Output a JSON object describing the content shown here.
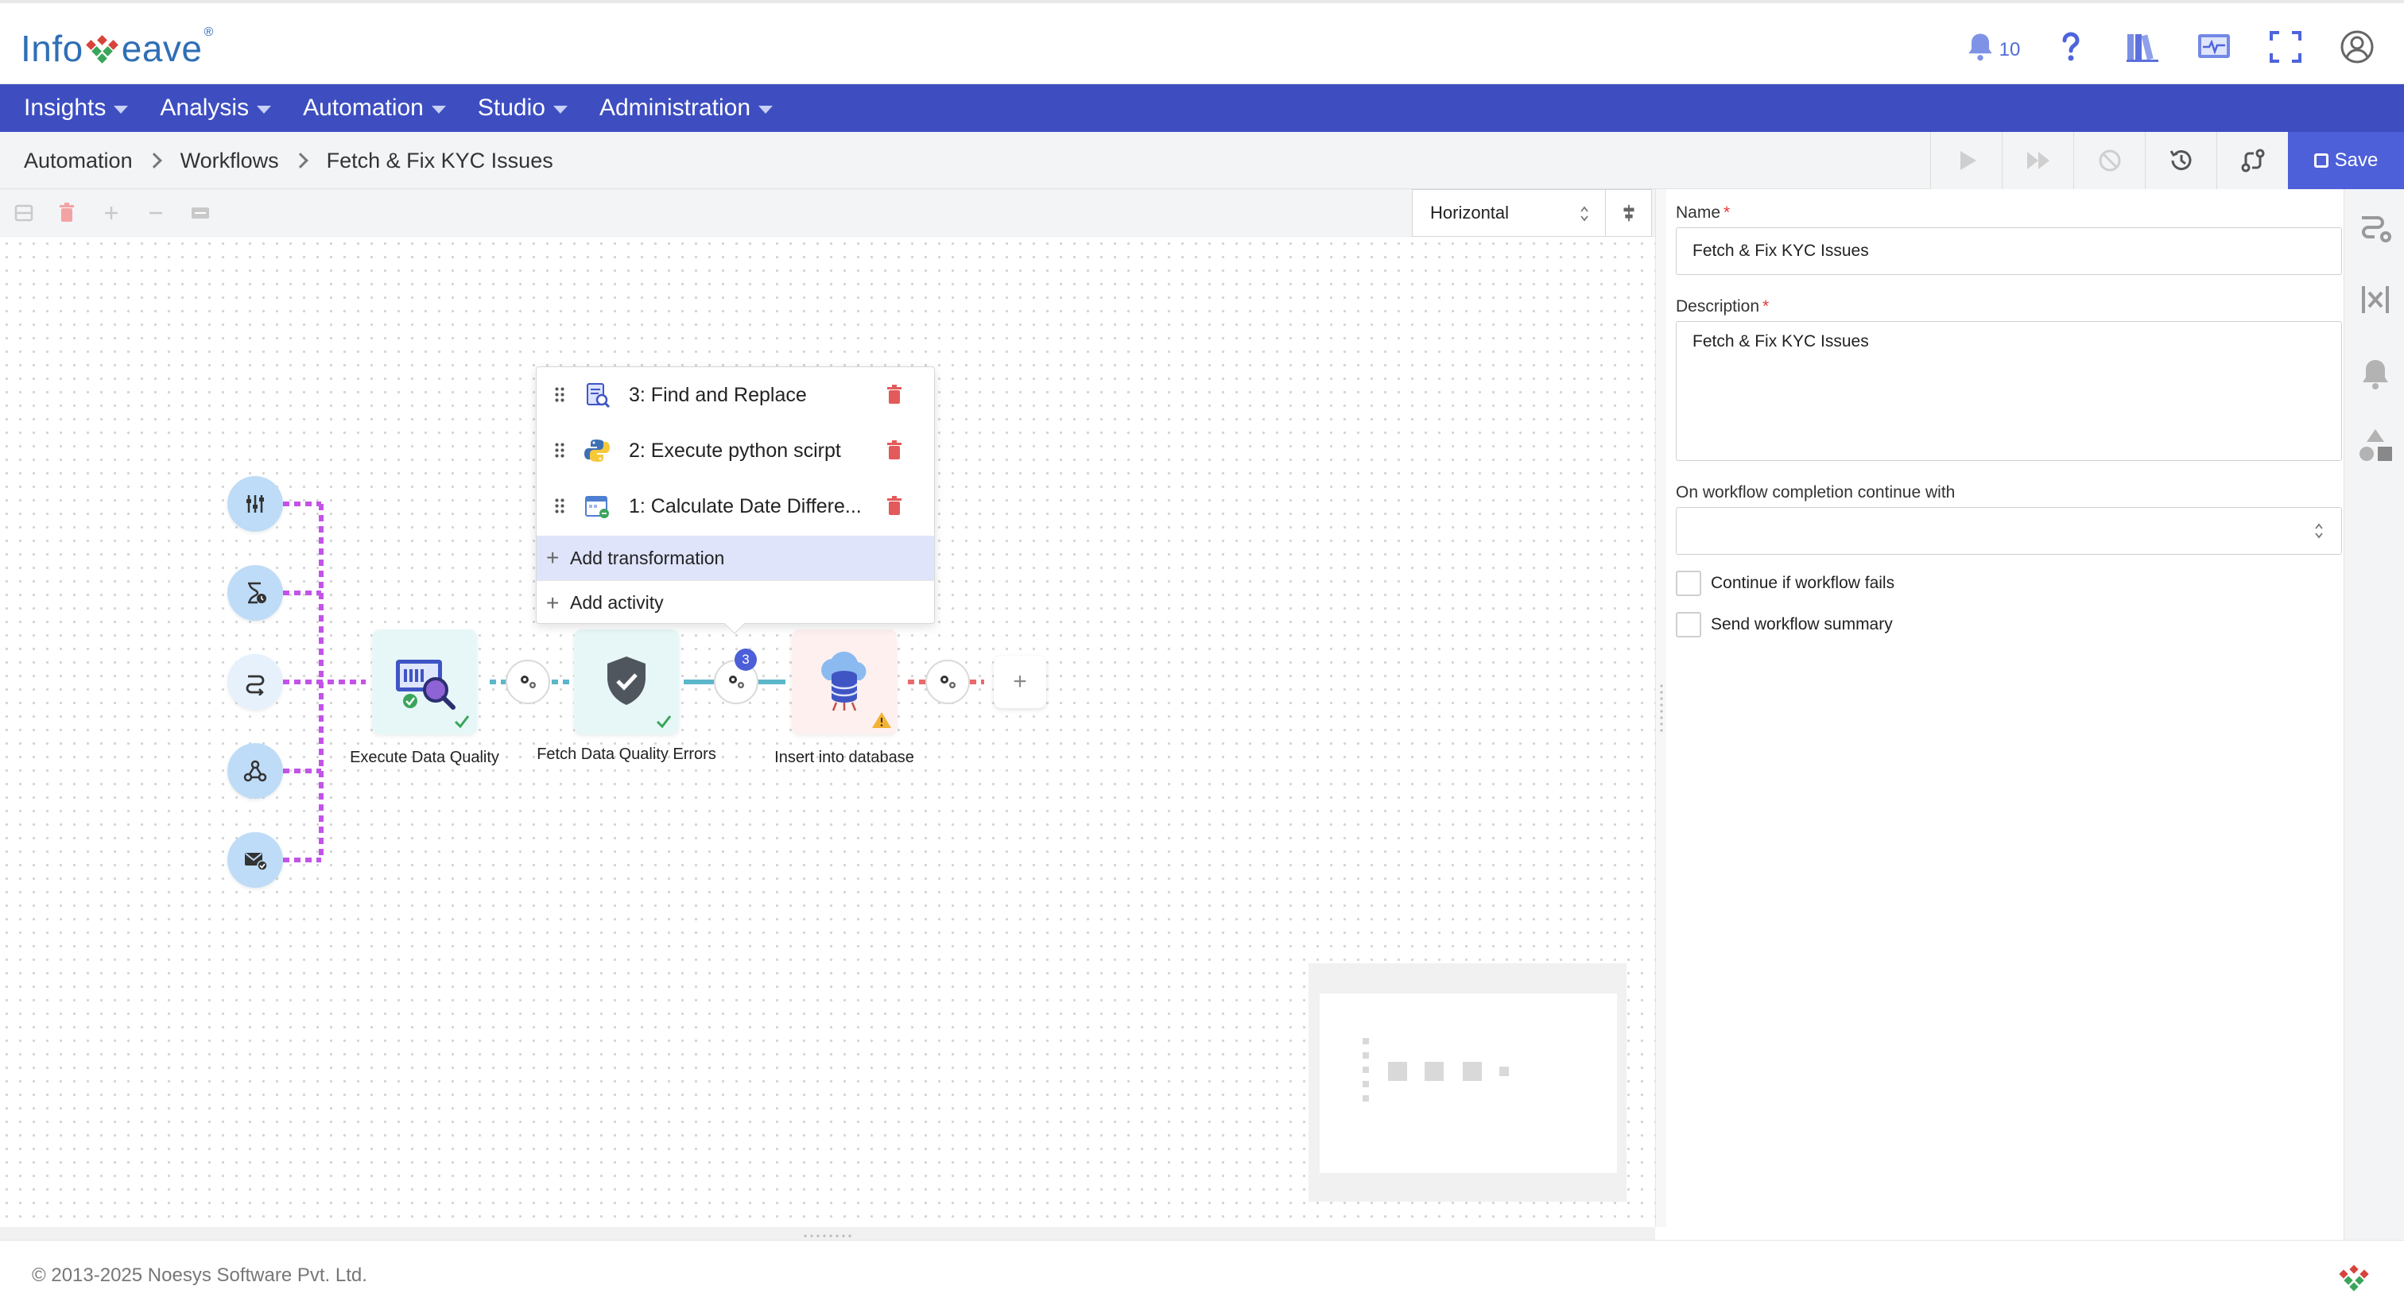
{
  "brand": {
    "logo_pre": "Info",
    "logo_post": "eave",
    "logo_tm": "®"
  },
  "header": {
    "notifications_count": "10"
  },
  "nav": {
    "items": [
      {
        "label": "Insights"
      },
      {
        "label": "Analysis"
      },
      {
        "label": "Automation"
      },
      {
        "label": "Studio"
      },
      {
        "label": "Administration"
      }
    ]
  },
  "breadcrumb": {
    "items": [
      "Automation",
      "Workflows",
      "Fetch & Fix KYC Issues"
    ]
  },
  "actions": {
    "save_label": "Save"
  },
  "canvas": {
    "orientation_value": "Horizontal",
    "nodes": {
      "n1": {
        "label": "Execute Data Quality"
      },
      "n2": {
        "label": "Fetch Data Quality Errors"
      },
      "n3": {
        "label": "Insert into database"
      }
    },
    "transform_count": "3",
    "add_plus": "+",
    "popup": {
      "transformations": [
        {
          "label": "3: Find and Replace"
        },
        {
          "label": "2: Execute python scirpt"
        },
        {
          "label": "1: Calculate Date Differe..."
        }
      ],
      "add_transformation": "Add transformation",
      "add_activity": "Add activity"
    }
  },
  "panel": {
    "name_label": "Name",
    "name_value": "Fetch & Fix KYC Issues",
    "description_label": "Description",
    "description_value": "Fetch & Fix KYC Issues",
    "required_mark": "*",
    "completion_label": "On workflow completion continue with",
    "completion_value": "",
    "continue_if_fails": "Continue if workflow fails",
    "send_summary": "Send workflow summary"
  },
  "footer": {
    "copyright": "© 2013-2025 Noesys Software Pvt. Ltd."
  },
  "colors": {
    "nav_bg": "#3e4ec1",
    "save_bg": "#4d5fd9",
    "trigger_bg": "#bedcf7",
    "dotted_purple": "#c353e8",
    "link_teal": "#5bb7c9",
    "link_red": "#e86a6a",
    "delete_red": "#e35a5a"
  }
}
